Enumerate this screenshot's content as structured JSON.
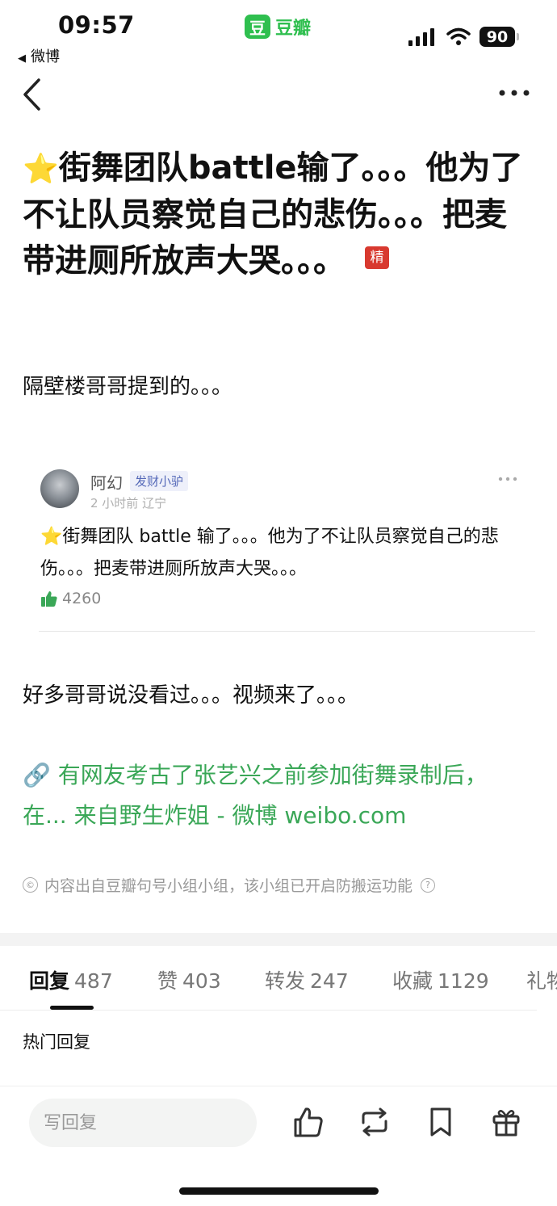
{
  "status_bar": {
    "time": "09:57",
    "back_app": "微博",
    "app_name": "豆瓣",
    "app_logo_char": "豆",
    "battery": "90"
  },
  "nav": {
    "back_icon": "chevron-left-icon",
    "more_icon": "more-dots-icon"
  },
  "post": {
    "title_star": "⭐",
    "title": "街舞团队battle输了。。。他为了不让队员察觉自己的悲伤。。。把麦带进厕所放声大哭。。。",
    "featured_badge": "精",
    "paragraph1": "隔壁楼哥哥提到的。。。",
    "paragraph2": "好多哥哥说没看过。。。视频来了。。。",
    "link_icon": "🔗",
    "link_text": "有网友考古了张艺兴之前参加街舞录制后，在... 来自野生炸姐 - 微博 weibo.com",
    "copyright": "内容出自豆瓣句号小组小组，该小组已开启防搬运功能",
    "copyright_symbol": "©",
    "help_symbol": "?"
  },
  "quote": {
    "username": "阿幻",
    "tag": "发财小驴",
    "meta": "2 小时前 辽宁",
    "star": "⭐",
    "text": "街舞团队 battle 输了。。。他为了不让队员察觉自己的悲伤。。。把麦带进厕所放声大哭。。。",
    "likes": "4260"
  },
  "tabs": [
    {
      "label": "回复",
      "count": "487"
    },
    {
      "label": "赞",
      "count": "403"
    },
    {
      "label": "转发",
      "count": "247"
    },
    {
      "label": "收藏",
      "count": "1129"
    },
    {
      "label": "礼物",
      "count": ""
    }
  ],
  "hot_replies_label": "热门回复",
  "bottom_bar": {
    "reply_placeholder": "写回复",
    "icons": [
      "thumbs-up-icon",
      "repost-icon",
      "bookmark-icon",
      "gift-icon"
    ]
  },
  "colors": {
    "accent_green": "#3aa757",
    "badge_red": "#d8392f",
    "douban_green": "#2fbf4f"
  }
}
